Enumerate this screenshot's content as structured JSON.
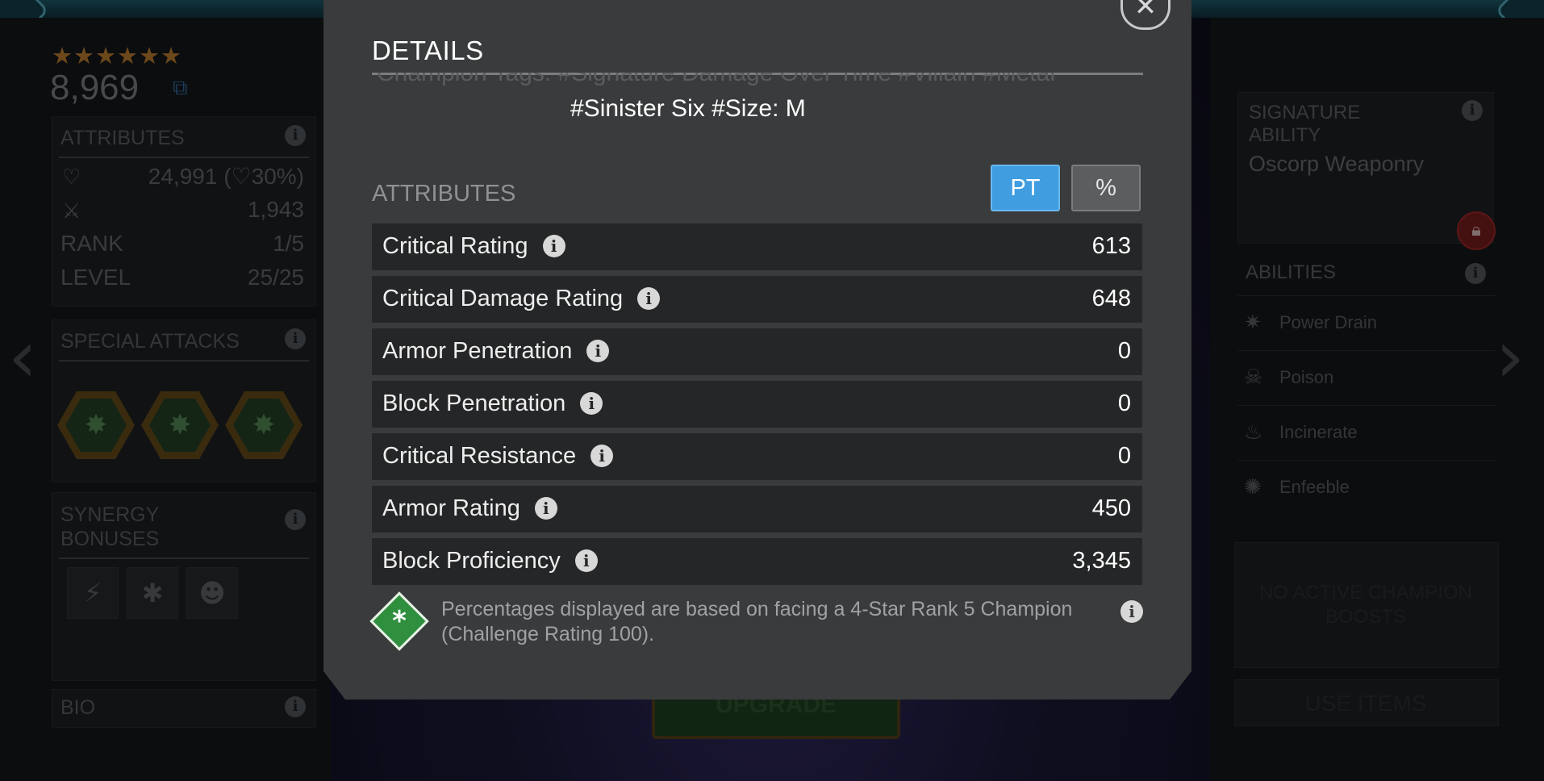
{
  "champion": {
    "stars": "★★★★★★",
    "power": "8,969",
    "attributes_title": "ATTRIBUTES",
    "health_value": "24,991",
    "health_pct": "30%)",
    "health_paren": "(",
    "attack_value": "1,943",
    "rank_label": "RANK",
    "rank_value": "1/5",
    "level_label": "LEVEL",
    "level_value": "25/25",
    "special_attacks_title": "SPECIAL ATTACKS",
    "synergy_title": "SYNERGY BONUSES",
    "bio_title": "BIO",
    "upgrade_label": "UPGRADE"
  },
  "right_panel": {
    "signature_title": "SIGNATURE ABILITY",
    "signature_name": "Oscorp Weaponry",
    "abilities_title": "ABILITIES",
    "abilities": [
      {
        "label": "Power Drain",
        "icon": "power-drain-icon"
      },
      {
        "label": "Poison",
        "icon": "skull-icon"
      },
      {
        "label": "Incinerate",
        "icon": "flame-icon"
      },
      {
        "label": "Enfeeble",
        "icon": "enfeeble-icon"
      }
    ],
    "boosts_text": "NO ACTIVE CHAMPION BOOSTS",
    "use_items_label": "USE ITEMS"
  },
  "modal": {
    "title": "DETAILS",
    "tags_faded": "Champion Tags: #Signature Damage Over Time #Villain #Metal",
    "tags_line": "#Sinister Six #Size: M",
    "attributes_title": "ATTRIBUTES",
    "toggle_pt": "PT",
    "toggle_pct": "%",
    "rows": [
      {
        "label": "Critical Rating",
        "value": "613"
      },
      {
        "label": "Critical Damage Rating",
        "value": "648"
      },
      {
        "label": "Armor Penetration",
        "value": "0"
      },
      {
        "label": "Block Penetration",
        "value": "0"
      },
      {
        "label": "Critical Resistance",
        "value": "0"
      },
      {
        "label": "Armor Rating",
        "value": "450"
      },
      {
        "label": "Block Proficiency",
        "value": "3,345"
      }
    ],
    "note": "Percentages displayed are based on facing a 4-Star Rank 5 Champion (Challenge Rating 100)."
  },
  "colors": {
    "accent_blue": "#3f9de0",
    "note_green": "#2f8f3f",
    "modal_bg": "#3a3b3c",
    "row_bg": "#252627"
  }
}
